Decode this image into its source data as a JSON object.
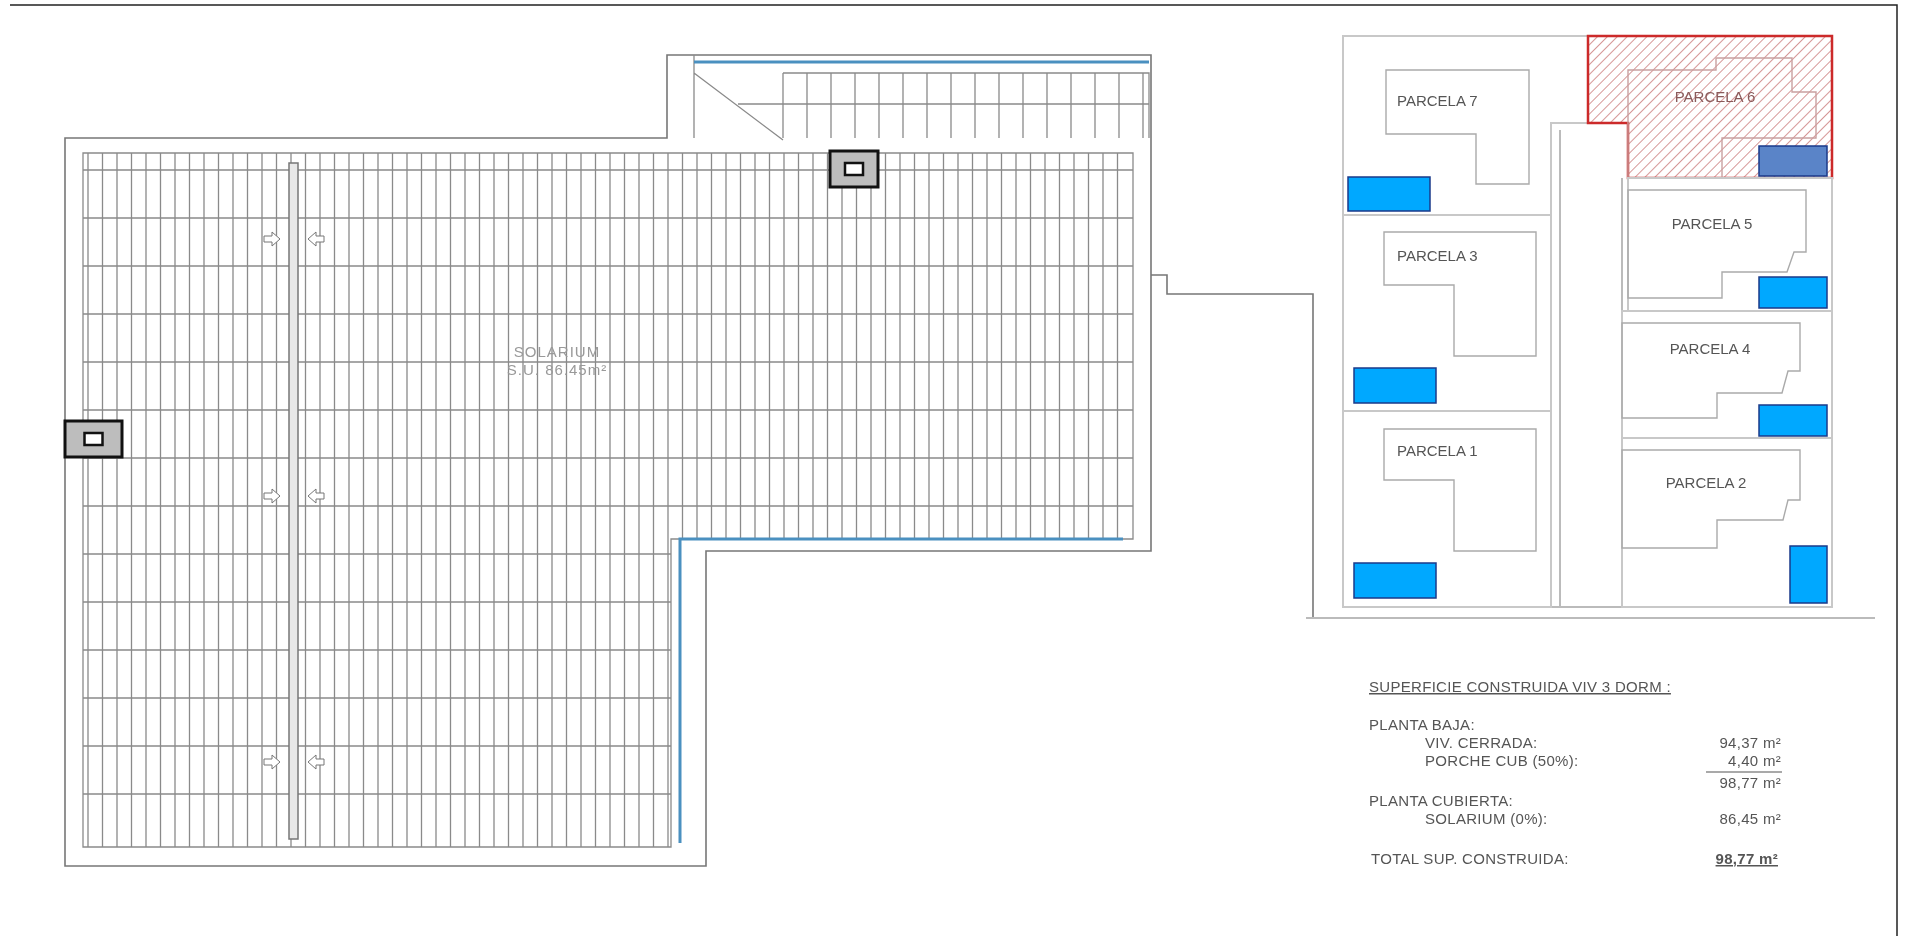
{
  "solarium_plan": {
    "label": "SOLARIUM",
    "area": "S.U. 86.45m²"
  },
  "site_plan": {
    "parcels": [
      {
        "label": "PARCELA 7",
        "selected": false
      },
      {
        "label": "PARCELA 6",
        "selected": true
      },
      {
        "label": "PARCELA 5",
        "selected": false
      },
      {
        "label": "PARCELA 3",
        "selected": false
      },
      {
        "label": "PARCELA 4",
        "selected": false
      },
      {
        "label": "PARCELA 1",
        "selected": false
      },
      {
        "label": "PARCELA 2",
        "selected": false
      }
    ]
  },
  "area_table": {
    "title": "SUPERFICIE CONSTRUIDA VIV 3 DORM :",
    "sections": [
      {
        "heading": "PLANTA BAJA:",
        "rows": [
          {
            "label": "VIV. CERRADA:",
            "value": "94,37 m²"
          },
          {
            "label": "PORCHE CUB (50%):",
            "value": "4,40 m²"
          }
        ],
        "subtotal": "98,77 m²"
      },
      {
        "heading": "PLANTA CUBIERTA:",
        "rows": [
          {
            "label": "SOLARIUM (0%):",
            "value": "86,45 m²"
          }
        ]
      }
    ],
    "total": {
      "label": "TOTAL SUP. CONSTRUIDA:",
      "value": "98,77 m²"
    }
  }
}
